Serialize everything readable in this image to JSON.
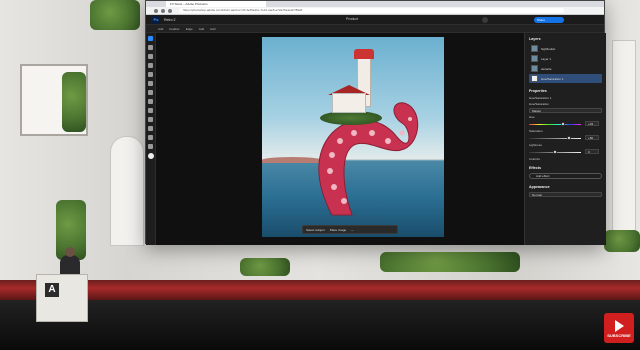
{
  "browser": {
    "tab_title": "FX Stock ~ Adobe Photosho",
    "url": "https://photoshop.adobe.com/id/urn:aaid:sc:US:3e45e2bc-7e31-4ac5-a7a9-f5e4e0c789a5"
  },
  "photoshop": {
    "doc_title": "Retro 2",
    "top_center": "Product",
    "share_label": "Share",
    "options": [
      "Add",
      "Feather",
      "Edge",
      "Add",
      "Add"
    ],
    "tools_count": 14
  },
  "context_bar": {
    "select_subject": "Select subject",
    "place_image": "Place image"
  },
  "layers_panel": {
    "title": "Layers",
    "layers": [
      {
        "name": "hightlookin",
        "selected": false
      },
      {
        "name": "Layer 1",
        "selected": false
      },
      {
        "name": "tentacle",
        "selected": false
      },
      {
        "name": "Hue/Saturation 1",
        "selected": true
      }
    ]
  },
  "properties_panel": {
    "title": "Properties",
    "adjustment": "Hue/Saturation 1",
    "section": "Hue/Saturation",
    "preset": "Master",
    "hue_label": "Hue",
    "hue_value": "+33",
    "saturation_label": "Saturation",
    "saturation_value": "+50",
    "lightness_label": "Lightness",
    "lightness_value": "0",
    "colorize_label": "Colorize",
    "effects_title": "Effects",
    "add_effect": "Add effect",
    "appearance_title": "Appearance",
    "blend_mode": "Normal"
  },
  "overlay": {
    "subscribe": "SUBSCRIBE"
  },
  "colors": {
    "accent": "#2b8cff",
    "panel_bg": "#1f1f1f",
    "stage_red": "#a82a2a"
  }
}
